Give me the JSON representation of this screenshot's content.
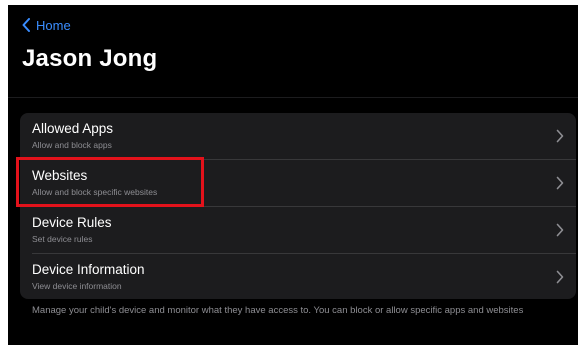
{
  "nav": {
    "back_label": "Home"
  },
  "page": {
    "title": "Jason Jong"
  },
  "rows": [
    {
      "title": "Allowed Apps",
      "subtitle": "Allow and block apps"
    },
    {
      "title": "Websites",
      "subtitle": "Allow and block specific websites"
    },
    {
      "title": "Device Rules",
      "subtitle": "Set device rules"
    },
    {
      "title": "Device Information",
      "subtitle": "View device information"
    }
  ],
  "footer": {
    "note": "Manage your child's device and monitor what they have access to. You can block or allow specific apps and websites"
  },
  "colors": {
    "accent": "#3a8dff",
    "background": "#000000",
    "list_background": "#1c1c1e",
    "secondary_text": "#8e8e93",
    "highlight": "#e3121b"
  },
  "icons": {
    "back": "chevron-left-icon",
    "row": "chevron-right-icon"
  }
}
